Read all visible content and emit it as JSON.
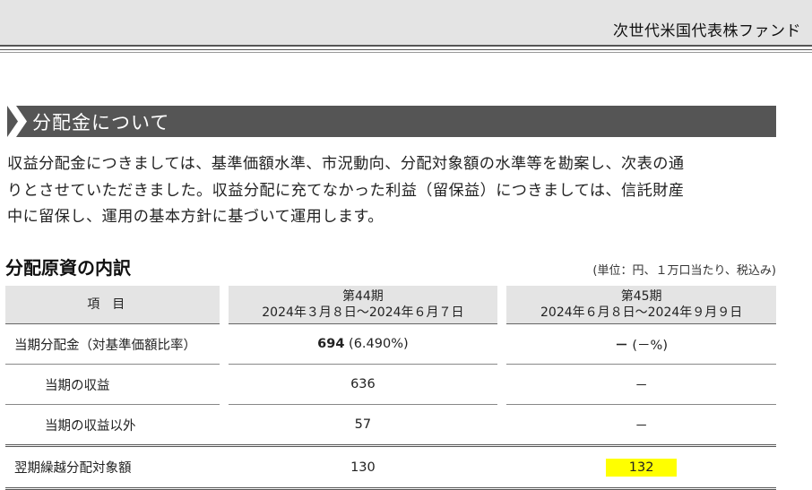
{
  "header": {
    "fund_name": "次世代米国代表株ファンド"
  },
  "section": {
    "title": "分配金について"
  },
  "paragraph": {
    "lines": [
      "収益分配金につきましては、基準価額水準、市況動向、分配対象額の水準等を勘案し、次表の通",
      "りとさせていただきました。収益分配に充てなかった利益（留保益）につきましては、信託財産",
      "中に留保し、運用の基本方針に基づいて運用します。"
    ]
  },
  "table": {
    "title": "分配原資の内訳",
    "unit_note": "(単位：円、１万口当たり、税込み)",
    "header_item": "項目",
    "periods": [
      {
        "name": "第44期",
        "range": "2024年３月８日～2024年６月７日"
      },
      {
        "name": "第45期",
        "range": "2024年６月８日～2024年９月９日"
      }
    ],
    "rows": [
      {
        "label": "当期分配金（対基準価額比率）",
        "p44_main": "694",
        "p44_ratio": "(6.490%)",
        "p45_main": "－",
        "p45_ratio": "(－%)"
      },
      {
        "label": "当期の収益",
        "p44": "636",
        "p45": "－"
      },
      {
        "label": "当期の収益以外",
        "p44": "57",
        "p45": "－"
      },
      {
        "label": "翌期繰越分配対象額",
        "p44": "130",
        "p45": "132"
      }
    ]
  },
  "colors": {
    "section_bar": "#555555",
    "header_bg": "#e4e4e4",
    "highlight": "#ffff00"
  }
}
